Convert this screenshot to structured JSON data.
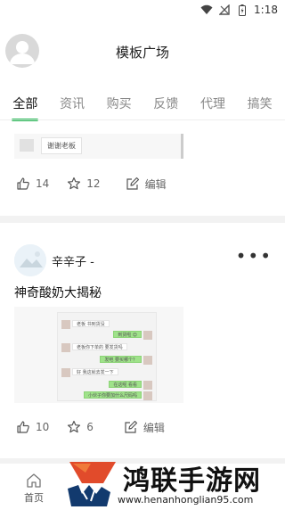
{
  "status_bar": {
    "time": "1:18"
  },
  "header": {
    "title": "模板广场"
  },
  "tabs": [
    {
      "label": "全部",
      "active": true
    },
    {
      "label": "资讯",
      "active": false
    },
    {
      "label": "购买",
      "active": false
    },
    {
      "label": "反馈",
      "active": false
    },
    {
      "label": "代理",
      "active": false
    },
    {
      "label": "搞笑",
      "active": false
    }
  ],
  "post1": {
    "image_text": "谢谢老板",
    "likes": "14",
    "stars": "12",
    "edit_label": "编辑"
  },
  "post2": {
    "author": "辛辛子 -",
    "title": "神奇酸奶大揭秘",
    "chat_lines": [
      "老板 书到货没",
      "到货啦 😊",
      "老板你下单的 要发货吗",
      "发吧 要买哪个？",
      "好 我这就去发一下",
      "在这呢 看看",
      "小伙子你要加什么尺码吗"
    ],
    "likes": "10",
    "stars": "6",
    "edit_label": "编辑"
  },
  "bottom_nav": {
    "home_label": "首页"
  },
  "watermark": {
    "title": "鸿联手游网",
    "url": "www.henanhonglian95.com"
  },
  "colors": {
    "accent": "#19b34a",
    "divider": "#f2f2f2"
  }
}
